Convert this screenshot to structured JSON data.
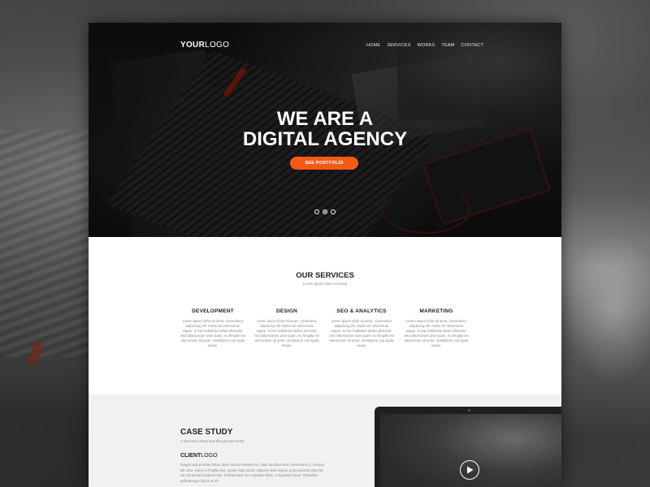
{
  "logo": {
    "bold": "YOUR",
    "light": "LOGO"
  },
  "nav": [
    "HOME",
    "SERVICES",
    "WORKS",
    "TEAM",
    "CONTACT"
  ],
  "hero": {
    "line1": "WE ARE A",
    "line2": "DIGITAL AGENCY",
    "cta": "SEE PORTFOLIO",
    "slides_total": 3,
    "active_slide": 2
  },
  "services": {
    "title": "OUR SERVICES",
    "subtitle": "Lorem ipsum dolor sit amet",
    "items": [
      {
        "title": "DEVELOPMENT",
        "text": "Lorem ipsum dolor sit amet, consectetur adipiscing elit. Morbi vel elementum augue. In hac habitasse platea dictumst. Sed ullamcorper ante quam, eu fringilla est elementum sit amet. Vestibulum non ligula neque."
      },
      {
        "title": "DESIGN",
        "text": "Lorem ipsum dolor sit amet, consectetur adipiscing elit. Morbi vel elementum augue. In hac habitasse platea dictumst. Sed ullamcorper ante quam, eu fringilla est elementum sit amet. Vestibulum non ligula neque."
      },
      {
        "title": "SEO & ANALYTICS",
        "text": "Lorem ipsum dolor sit amet, consectetur adipiscing elit. Morbi vel elementum augue. In hac habitasse platea dictumst. Sed ullamcorper ante quam, eu fringilla est elementum sit amet. Vestibulum non ligula neque."
      },
      {
        "title": "MARKETING",
        "text": "Lorem ipsum dolor sit amet, consectetur adipiscing elit. Morbi vel elementum augue. In hac habitasse platea dictumst. Sed ullamcorper ante quam, eu fringilla est elementum sit amet. Vestibulum non ligula neque."
      }
    ]
  },
  "case_study": {
    "title": "CASE STUDY",
    "subtitle": "A brief story about how this process works",
    "client_logo": {
      "bold": "CLIENT",
      "light": "LOGO"
    },
    "body": "Integer quis pulvinar tellus. Nunc varius hendrerit ex, vitae faucibus sem consectetur in. Aenean elit urna, varius et fringilla sed, iaculis vitae purus. Aliquam risus massa, porta pulvinar placerat vel, hendrerit tincidunt enim. Pellentesque nec vulputate diam, a dignissim lacus. Phasellus pellentesque luctus ex sit"
  },
  "colors": {
    "accent": "#f45a14",
    "hero_bg": "#141414",
    "case_bg": "#f1f1f1"
  },
  "icons": {
    "video_control": "play-icon"
  }
}
